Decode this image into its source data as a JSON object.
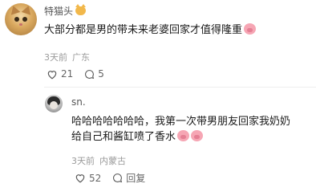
{
  "comments": [
    {
      "username": "特猫头",
      "text": "大部分都是男的带未来老婆回家才值得隆重",
      "time": "3天前",
      "location": "广东",
      "likes": "21",
      "replies": "5"
    },
    {
      "username": "sn.",
      "text_line1": "哈哈哈哈哈哈哈，我第一次带男朋友回家我奶奶",
      "text_line2": "给自己和酱缸喷了香水",
      "time": "3天前",
      "location": "内蒙古",
      "likes": "52",
      "reply_label": "回复"
    }
  ],
  "icons": {
    "badge": "cat-face-emoji",
    "emoji": "pig-face-emoji",
    "like": "heart-icon",
    "reply": "comment-bubble-icon"
  }
}
